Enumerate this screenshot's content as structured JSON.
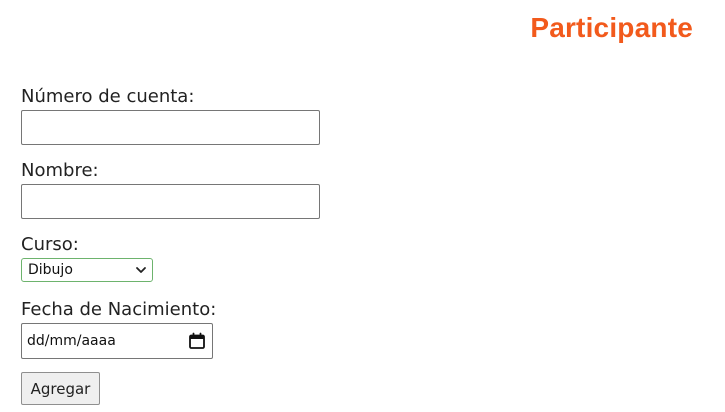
{
  "header": {
    "title": "Participante",
    "title_color": "#f25a1c"
  },
  "form": {
    "account_number": {
      "label": "Número de cuenta:",
      "value": ""
    },
    "name": {
      "label": "Nombre:",
      "value": ""
    },
    "course": {
      "label": "Curso:",
      "selected": "Dibujo",
      "icon": "chevron-down-icon",
      "border_color": "#6db36d"
    },
    "birth_date": {
      "label": "Fecha de Nacimiento:",
      "placeholder": "dd/mm/aaaa",
      "icon": "calendar-icon"
    },
    "submit_label": "Agregar"
  }
}
